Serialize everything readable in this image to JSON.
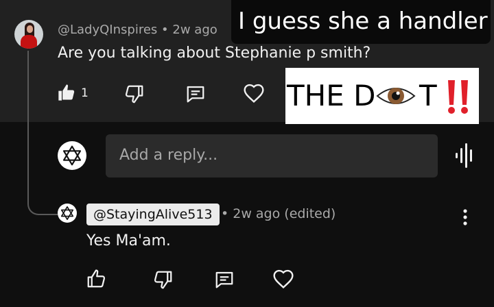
{
  "top_comment": {
    "author": "@LadyQInspires",
    "separator": "•",
    "time": "2w ago",
    "text": "Are you talking about Stephanie p smith?",
    "like_count": "1"
  },
  "overlay_captions": {
    "caption_top": "I guess she a handler",
    "caption_left": "THE D",
    "caption_right": "T"
  },
  "reply_box": {
    "placeholder": "Add a reply..."
  },
  "reply": {
    "author": "@StayingAlive513",
    "meta": "• 2w ago (edited)",
    "text": "Yes Ma'am."
  },
  "icons": {
    "like": "thumbs-up-icon",
    "dislike": "thumbs-down-icon",
    "reply": "comment-icon",
    "heart": "heart-icon",
    "avatar_star": "star-of-david-icon",
    "voice": "voice-search-icon",
    "more": "more-vert-icon"
  },
  "colors": {
    "top_band": "#212121",
    "page_bg": "#0f0f0f",
    "input_bg": "#2b2b2b",
    "meta_text": "#aaaaaa",
    "text": "#f1f1f1",
    "alarm_red": "#e0202a"
  }
}
